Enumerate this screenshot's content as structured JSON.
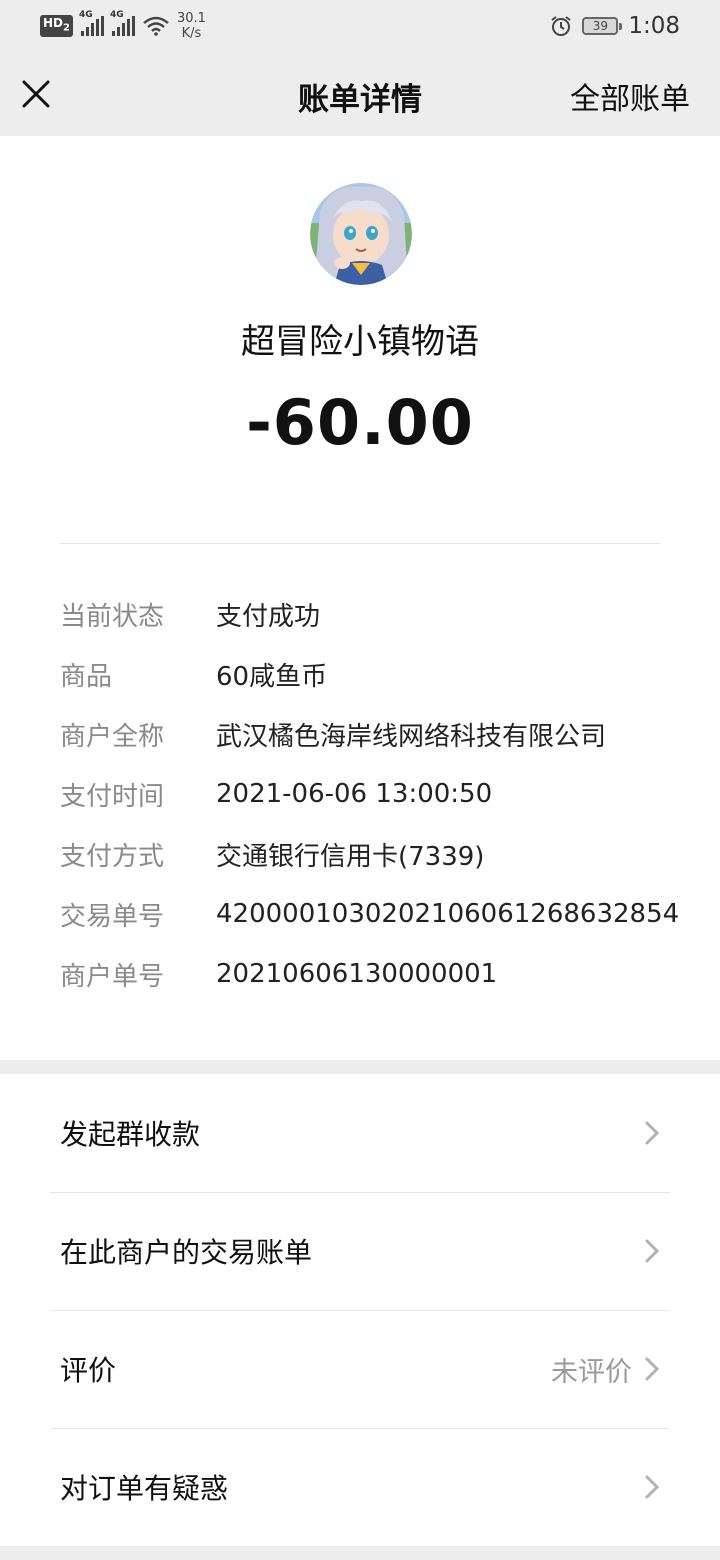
{
  "status_bar": {
    "hd": "HD",
    "hd_sub": "2",
    "network_1": "4G",
    "network_2": "4G",
    "speed_value": "30.1",
    "speed_unit": "K/s",
    "battery": "39",
    "time": "1:08"
  },
  "nav": {
    "title": "账单详情",
    "right_action": "全部账单"
  },
  "merchant": {
    "name": "超冒险小镇物语",
    "amount": "-60.00"
  },
  "details": [
    {
      "label": "当前状态",
      "value": "支付成功"
    },
    {
      "label": "商品",
      "value": "60咸鱼币"
    },
    {
      "label": "商户全称",
      "value": "武汉橘色海岸线网络科技有限公司"
    },
    {
      "label": "支付时间",
      "value": "2021-06-06 13:00:50"
    },
    {
      "label": "支付方式",
      "value": "交通银行信用卡(7339)"
    },
    {
      "label": "交易单号",
      "value": "4200001030202106061268632854"
    },
    {
      "label": "商户单号",
      "value": "20210606130000001"
    }
  ],
  "actions": [
    {
      "label": "发起群收款",
      "status": ""
    },
    {
      "label": "在此商户的交易账单",
      "status": ""
    },
    {
      "label": "评价",
      "status": "未评价"
    },
    {
      "label": "对订单有疑惑",
      "status": ""
    }
  ],
  "colors": {
    "page_background": "#ededed",
    "card_background": "#ffffff",
    "label_gray": "#8a8a8a",
    "text_dark": "#111111"
  }
}
